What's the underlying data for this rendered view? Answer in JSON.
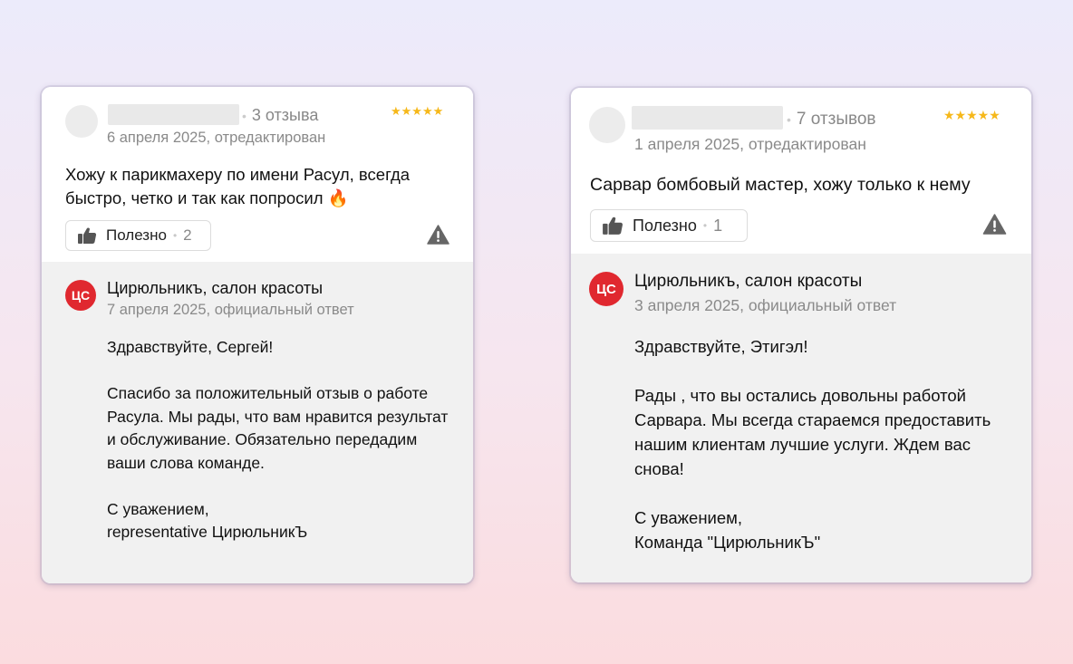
{
  "reviews": [
    {
      "review_count": "3 отзыва",
      "date": "6 апреля 2025, отредактирован",
      "rating_stars": "★★★★★",
      "text": "Хожу к парикмахеру по имени Расул, всегда быстро, четко и так как попросил 🔥",
      "helpful_label": "Полезно",
      "helpful_count": "2",
      "reply": {
        "logo_text": "ЦС",
        "org_name": "Цирюльникъ, салон красоты",
        "date": "7 апреля 2025, официальный ответ",
        "body": "Здравствуйте, Сергей!\n\nСпасибо за положительный отзыв о работе Расула. Мы рады, что вам нравится результат и обслуживание. Обязательно передадим ваши слова команде.\n\nС уважением,\nrepresentative ЦирюльникЪ"
      }
    },
    {
      "review_count": "7 отзывов",
      "date": "1 апреля 2025, отредактирован",
      "rating_stars": "★★★★★",
      "text": "Сарвар бомбовый мастер, хожу только к нему",
      "helpful_label": "Полезно",
      "helpful_count": "1",
      "reply": {
        "logo_text": "ЦС",
        "org_name": "Цирюльникъ, салон красоты",
        "date": "3 апреля 2025, официальный ответ",
        "body": "Здравствуйте, Этигэл!\n\nРады , что вы остались довольны работой Сарвара. Мы всегда стараемся предоставить нашим клиентам лучшие услуги. Ждем вас снова!\n\nС уважением,\nКоманда \"ЦирюльникЪ\""
      }
    }
  ],
  "icons": {
    "thumbs_up": "thumbs-up-icon",
    "report": "warning-triangle-icon"
  },
  "colors": {
    "star": "#f6b81a",
    "logo_bg": "#e0282f",
    "reply_bg": "#f1f1f1"
  }
}
